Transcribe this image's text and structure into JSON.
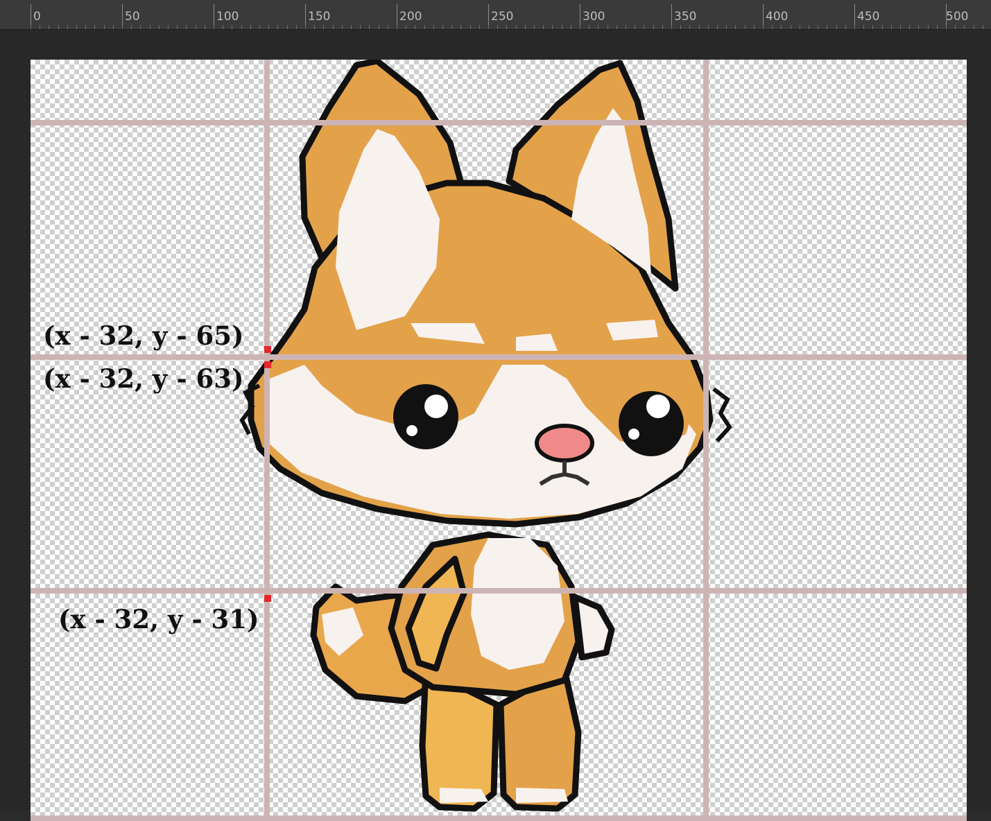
{
  "ruler": {
    "labels": [
      "0",
      "50",
      "100",
      "150",
      "200",
      "250",
      "300",
      "350",
      "400",
      "450",
      "500"
    ]
  },
  "annotations": {
    "label_a": "(x - 32, y - 65)",
    "label_b": "(x - 32, y - 63)",
    "label_c": "(x - 32, y - 31)"
  },
  "colors": {
    "guide": "#cdb4b4",
    "marker": "#e8262c",
    "fur": "#e3a24a",
    "fur_light": "#f0b653",
    "white": "#f8f2ef",
    "outline": "#111111",
    "nose": "#f08a8a"
  },
  "icons": {
    "sprite": "fox-sprite"
  }
}
